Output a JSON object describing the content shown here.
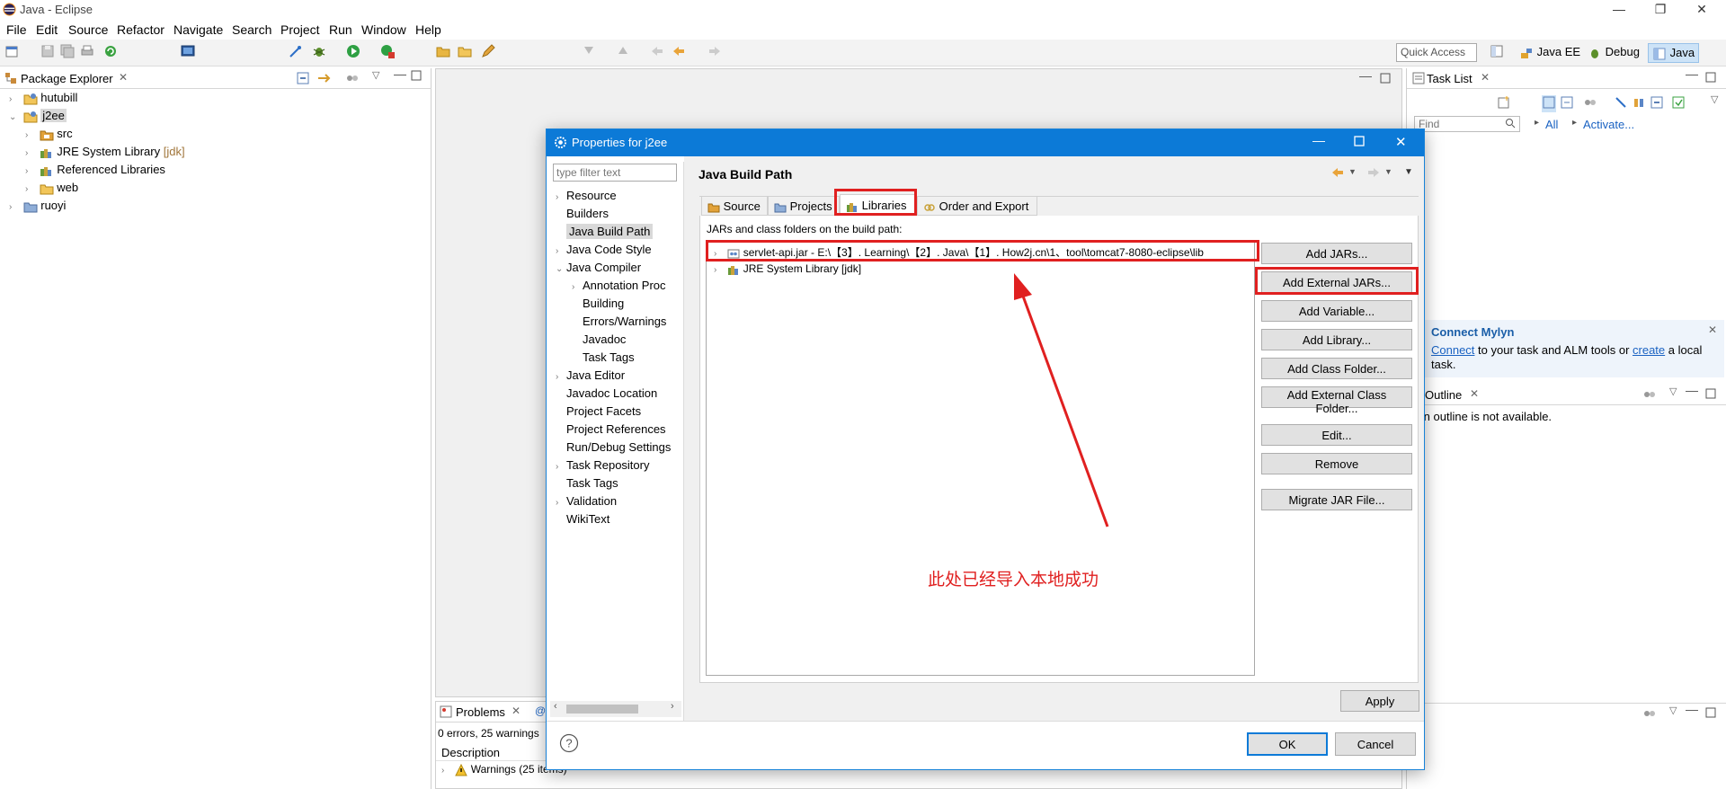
{
  "window": {
    "title": "Java - Eclipse",
    "controls": [
      "—",
      "❐",
      "✕"
    ]
  },
  "menu": [
    "File",
    "Edit",
    "Source",
    "Refactor",
    "Navigate",
    "Search",
    "Project",
    "Run",
    "Window",
    "Help"
  ],
  "toolbar": {
    "quick_access": "Quick Access"
  },
  "perspectives": {
    "java_ee": "Java EE",
    "debug": "Debug",
    "java": "Java"
  },
  "package_explorer": {
    "title": "Package Explorer",
    "items": [
      {
        "label": "hutubill"
      },
      {
        "label": "j2ee"
      },
      {
        "label": "src"
      },
      {
        "label": "JRE System Library",
        "suffix": "[jdk]"
      },
      {
        "label": "Referenced Libraries"
      },
      {
        "label": "web"
      },
      {
        "label": "ruoyi"
      }
    ]
  },
  "task_list": {
    "title": "Task List",
    "find_placeholder": "Find",
    "all": "All",
    "activate": "Activate..."
  },
  "mylyn": {
    "title": "Connect Mylyn",
    "connect": "Connect",
    "text_1": " to your task and ALM tools or ",
    "create": "create",
    "text_2": " a local task."
  },
  "outline": {
    "title": "Outline",
    "message": "An outline is not available."
  },
  "problems": {
    "title": "Problems",
    "summary": "0 errors, 25 warnings",
    "description": "Description",
    "warnings": "Warnings (25 items)"
  },
  "dialog": {
    "title": "Properties for j2ee",
    "filter_placeholder": "type filter text",
    "page_title": "Java Build Path",
    "nav": [
      {
        "label": "Resource",
        "chevron": true,
        "level": 0
      },
      {
        "label": "Builders",
        "chevron": false,
        "level": 0
      },
      {
        "label": "Java Build Path",
        "chevron": false,
        "level": 0,
        "selected": true
      },
      {
        "label": "Java Code Style",
        "chevron": true,
        "level": 0
      },
      {
        "label": "Java Compiler",
        "chevron": true,
        "level": 0,
        "expanded": true
      },
      {
        "label": "Annotation Proc",
        "chevron": true,
        "level": 1
      },
      {
        "label": "Building",
        "chevron": false,
        "level": 1
      },
      {
        "label": "Errors/Warnings",
        "chevron": false,
        "level": 1
      },
      {
        "label": "Javadoc",
        "chevron": false,
        "level": 1
      },
      {
        "label": "Task Tags",
        "chevron": false,
        "level": 1
      },
      {
        "label": "Java Editor",
        "chevron": true,
        "level": 0
      },
      {
        "label": "Javadoc Location",
        "chevron": false,
        "level": 0
      },
      {
        "label": "Project Facets",
        "chevron": false,
        "level": 0
      },
      {
        "label": "Project References",
        "chevron": false,
        "level": 0
      },
      {
        "label": "Run/Debug Settings",
        "chevron": false,
        "level": 0
      },
      {
        "label": "Task Repository",
        "chevron": true,
        "level": 0
      },
      {
        "label": "Task Tags",
        "chevron": false,
        "level": 0
      },
      {
        "label": "Validation",
        "chevron": true,
        "level": 0
      },
      {
        "label": "WikiText",
        "chevron": false,
        "level": 0
      }
    ],
    "tabs": {
      "source": "Source",
      "projects": "Projects",
      "libraries": "Libraries",
      "order": "Order and Export"
    },
    "jars_label": "JARs and class folders on the build path:",
    "entries": [
      "servlet-api.jar - E:\\【3】. Learning\\【2】. Java\\【1】. How2j.cn\\1、tool\\tomcat7-8080-eclipse\\lib",
      "JRE System Library [jdk]"
    ],
    "buttons": {
      "add_jars": "Add JARs...",
      "add_external_jars": "Add External JARs...",
      "add_variable": "Add Variable...",
      "add_library": "Add Library...",
      "add_class_folder": "Add Class Folder...",
      "add_external_class_folder": "Add External Class Folder...",
      "edit": "Edit...",
      "remove": "Remove",
      "migrate": "Migrate JAR File...",
      "apply": "Apply",
      "ok": "OK",
      "cancel": "Cancel"
    },
    "annotation": "此处已经导入本地成功"
  },
  "colors": {
    "accent": "#0c7ad7",
    "highlight": "#e02020",
    "selection": "#cce8ff"
  }
}
